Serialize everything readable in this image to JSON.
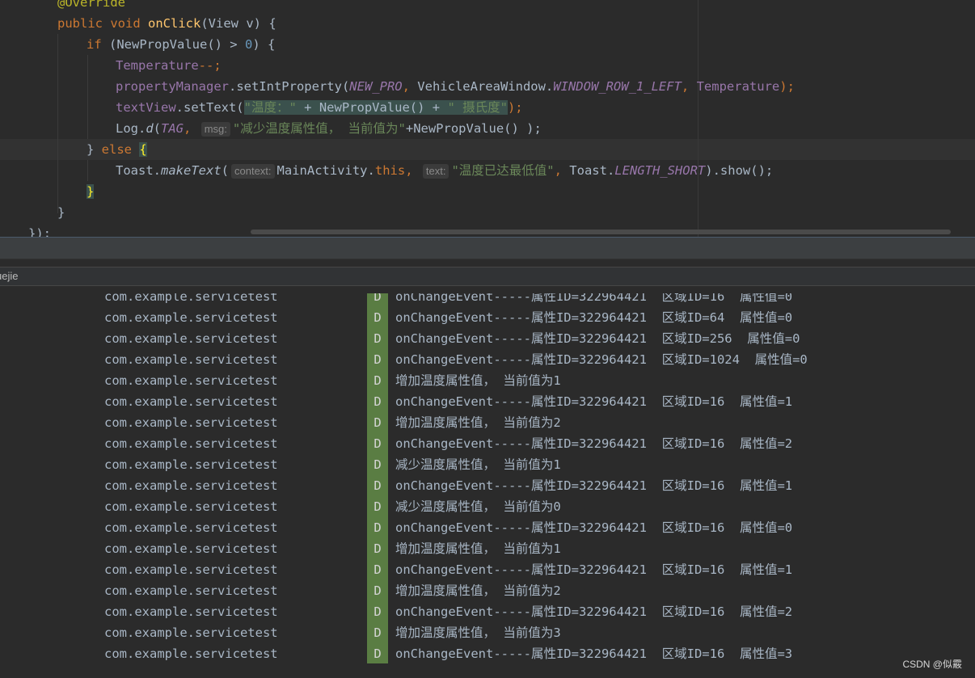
{
  "editor": {
    "line0": "@Override",
    "line1": {
      "kw_public": "public",
      "kw_void": "void",
      "method": "onClick",
      "params": "(View v) {"
    },
    "line2": {
      "kw_if": "if",
      "cond_open": " (NewPropValue() > ",
      "zero": "0",
      "cond_close": ") {"
    },
    "line3": {
      "field": "Temperature",
      "op": "--;"
    },
    "line4": {
      "obj": "propertyManager",
      "call": ".setIntProperty(",
      "arg1": "NEW_PRO",
      "sep1": ", ",
      "cls": "VehicleAreaWindow.",
      "arg2": "WINDOW_ROW_1_LEFT",
      "sep2": ", ",
      "arg3": "Temperature",
      "end": ");"
    },
    "line5": {
      "field": "textView",
      "call": ".setText(",
      "str1": "\"温度：\"",
      "mid": " + NewPropValue() + ",
      "str2": "\" 摄氏度\"",
      "end": ");"
    },
    "line6": {
      "obj": "Log.",
      "method": "d",
      "open": "(",
      "tag": "TAG",
      "sep": ", ",
      "hint": "msg:",
      "str": "\"减少温度属性值， 当前值为\"",
      "rest": "+NewPropValue() );"
    },
    "line7": {
      "close": "} ",
      "kw_else": "else",
      "brace": "{"
    },
    "line8": {
      "obj": "Toast.",
      "method": "makeText",
      "open": "(",
      "hint1": "context:",
      "ctx": "MainActivity.",
      "kw_this": "this",
      "sep": ", ",
      "hint2": "text:",
      "str": "\"温度已达最低值\"",
      "sep2": ", ",
      "cls": "Toast.",
      "const": "LENGTH_SHORT",
      "end": ").show();"
    },
    "line9": "}",
    "line10": "}",
    "line11": "});"
  },
  "filter": {
    "text": "uejie"
  },
  "log": {
    "rows": [
      {
        "pkg": "com.example.servicetest",
        "level": "D",
        "msg": "onChangeEvent-----属性ID=322964421  区域ID=16  属性值=0"
      },
      {
        "pkg": "com.example.servicetest",
        "level": "D",
        "msg": "onChangeEvent-----属性ID=322964421  区域ID=64  属性值=0"
      },
      {
        "pkg": "com.example.servicetest",
        "level": "D",
        "msg": "onChangeEvent-----属性ID=322964421  区域ID=256  属性值=0"
      },
      {
        "pkg": "com.example.servicetest",
        "level": "D",
        "msg": "onChangeEvent-----属性ID=322964421  区域ID=1024  属性值=0"
      },
      {
        "pkg": "com.example.servicetest",
        "level": "D",
        "msg": "增加温度属性值， 当前值为1"
      },
      {
        "pkg": "com.example.servicetest",
        "level": "D",
        "msg": "onChangeEvent-----属性ID=322964421  区域ID=16  属性值=1"
      },
      {
        "pkg": "com.example.servicetest",
        "level": "D",
        "msg": "增加温度属性值， 当前值为2"
      },
      {
        "pkg": "com.example.servicetest",
        "level": "D",
        "msg": "onChangeEvent-----属性ID=322964421  区域ID=16  属性值=2"
      },
      {
        "pkg": "com.example.servicetest",
        "level": "D",
        "msg": "减少温度属性值， 当前值为1"
      },
      {
        "pkg": "com.example.servicetest",
        "level": "D",
        "msg": "onChangeEvent-----属性ID=322964421  区域ID=16  属性值=1"
      },
      {
        "pkg": "com.example.servicetest",
        "level": "D",
        "msg": "减少温度属性值， 当前值为0"
      },
      {
        "pkg": "com.example.servicetest",
        "level": "D",
        "msg": "onChangeEvent-----属性ID=322964421  区域ID=16  属性值=0"
      },
      {
        "pkg": "com.example.servicetest",
        "level": "D",
        "msg": "增加温度属性值， 当前值为1"
      },
      {
        "pkg": "com.example.servicetest",
        "level": "D",
        "msg": "onChangeEvent-----属性ID=322964421  区域ID=16  属性值=1"
      },
      {
        "pkg": "com.example.servicetest",
        "level": "D",
        "msg": "增加温度属性值， 当前值为2"
      },
      {
        "pkg": "com.example.servicetest",
        "level": "D",
        "msg": "onChangeEvent-----属性ID=322964421  区域ID=16  属性值=2"
      },
      {
        "pkg": "com.example.servicetest",
        "level": "D",
        "msg": "增加温度属性值， 当前值为3"
      },
      {
        "pkg": "com.example.servicetest",
        "level": "D",
        "msg": "onChangeEvent-----属性ID=322964421  区域ID=16  属性值=3"
      }
    ]
  },
  "watermark": "CSDN @似霰"
}
